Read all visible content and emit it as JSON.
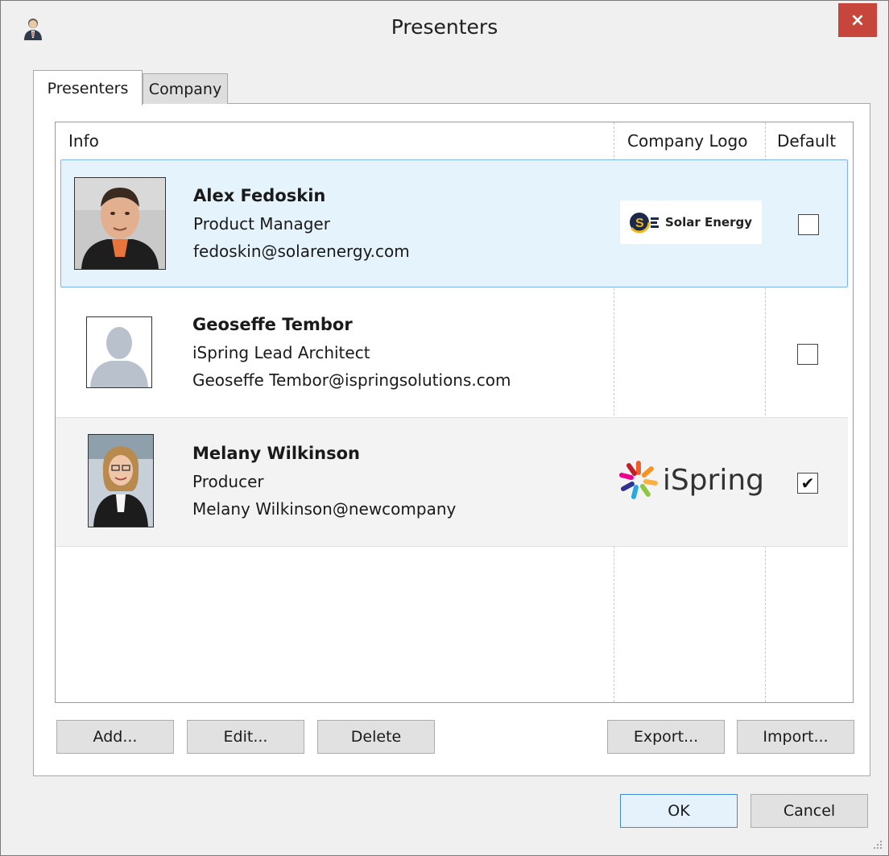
{
  "window": {
    "title": "Presenters",
    "close_label": "×"
  },
  "tabs": [
    {
      "label": "Presenters",
      "active": true
    },
    {
      "label": "Company",
      "active": false
    }
  ],
  "columns": {
    "info": "Info",
    "logo": "Company Logo",
    "default": "Default"
  },
  "presenters": [
    {
      "name": "Alex Fedoskin",
      "title": "Product Manager",
      "email": "fedoskin@solarenergy.com",
      "logo": "Solar Energy",
      "default": false,
      "selected": true
    },
    {
      "name": "Geoseffe Tembor",
      "title": "iSpring Lead Architect",
      "email": "Geoseffe Tembor@ispringsolutions.com",
      "logo": "",
      "default": false,
      "selected": false
    },
    {
      "name": "Melany Wilkinson",
      "title": "Producer",
      "email": "Melany Wilkinson@newcompany",
      "logo": "iSpring",
      "default": true,
      "selected": false
    }
  ],
  "buttons": {
    "add": "Add...",
    "edit": "Edit...",
    "delete": "Delete",
    "export": "Export...",
    "import": "Import...",
    "ok": "OK",
    "cancel": "Cancel"
  },
  "colors": {
    "close": "#c7463c",
    "selection": "#e5f3fd",
    "selection_border": "#7fb4ea",
    "ok_border": "#3c8fd6"
  },
  "checkmark": "✔"
}
